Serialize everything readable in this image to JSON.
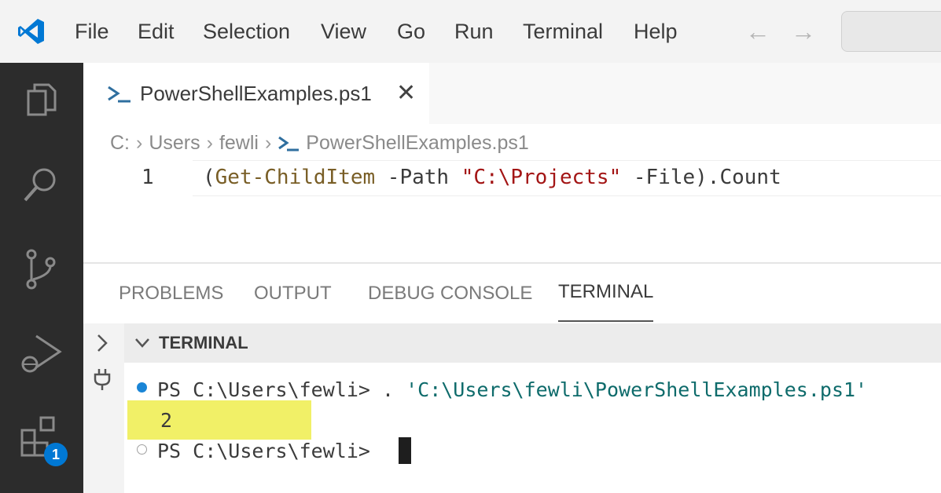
{
  "menu": [
    "File",
    "Edit",
    "Selection",
    "View",
    "Go",
    "Run",
    "Terminal",
    "Help"
  ],
  "nav": {
    "back": "←",
    "forward": "→"
  },
  "activity_badge": "1",
  "editor_tab": {
    "label": "PowerShellExamples.ps1",
    "close": "✕"
  },
  "breadcrumb": [
    "C:",
    "Users",
    "fewli",
    "PowerShellExamples.ps1"
  ],
  "code": {
    "line_number": "1",
    "tokens": [
      {
        "text": "(",
        "color": "#3b3b3b"
      },
      {
        "text": "Get-ChildItem",
        "color": "#795e26"
      },
      {
        "text": " -Path ",
        "color": "#3b3b3b"
      },
      {
        "text": "\"C:\\Projects\"",
        "color": "#a31515"
      },
      {
        "text": " -File",
        "color": "#3b3b3b"
      },
      {
        "text": ").Count",
        "color": "#3b3b3b"
      }
    ]
  },
  "panel_tabs": [
    "PROBLEMS",
    "OUTPUT",
    "DEBUG CONSOLE",
    "TERMINAL"
  ],
  "terminal": {
    "section_label": "TERMINAL",
    "line1_prompt": "PS C:\\Users\\fewli> ",
    "line1_cmd": ". ",
    "line1_arg": "'C:\\Users\\fewli\\PowerShellExamples.ps1'",
    "output": "2",
    "line2_prompt": "PS C:\\Users\\fewli> "
  },
  "colors": {
    "accent": "#0078d4",
    "highlight": "#f1f067",
    "string": "#a31515",
    "terminal_string": "#0e6b6b"
  }
}
